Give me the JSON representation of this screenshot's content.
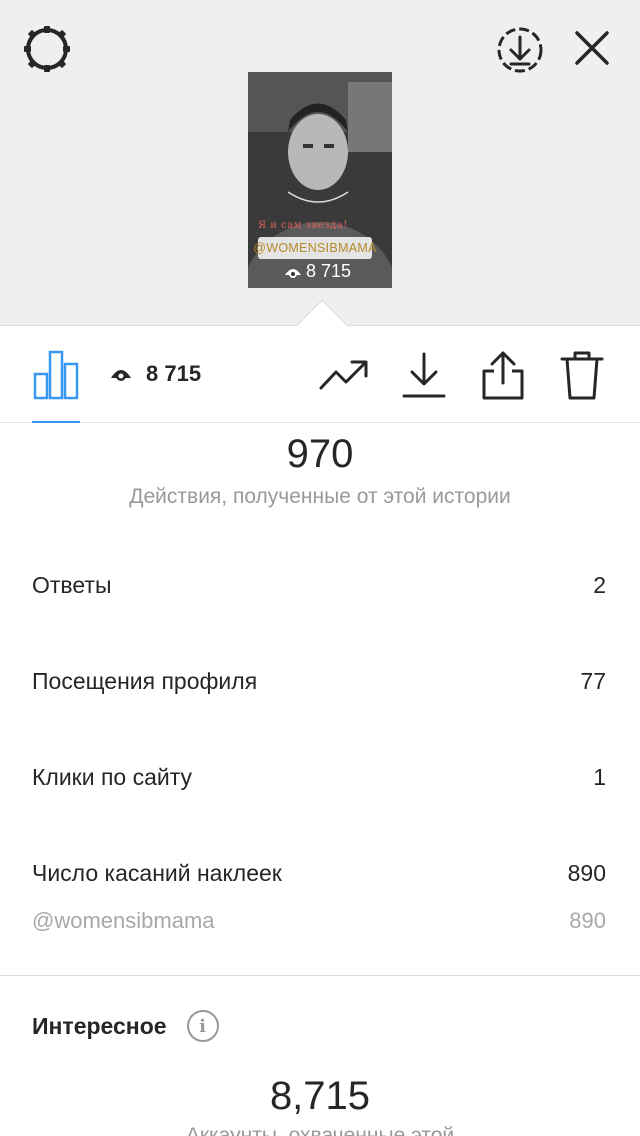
{
  "story": {
    "caption": "Я и сам звезда!",
    "mention_sticker": "@WOMENSIBMAMA",
    "views": "8 715"
  },
  "toolbar": {
    "views": "8 715"
  },
  "summary": {
    "value": "970",
    "description": "Действия, полученные от этой истории"
  },
  "rows": [
    {
      "label": "Ответы",
      "value": "2"
    },
    {
      "label": "Посещения профиля",
      "value": "77"
    },
    {
      "label": "Клики по сайту",
      "value": "1"
    },
    {
      "label": "Число касаний наклеек",
      "value": "890"
    }
  ],
  "sticker_row": {
    "label": "@womensibmama",
    "value": "890"
  },
  "discovery": {
    "title": "Интересное",
    "value": "8,715",
    "description": "Аккаунты, охваченные этой"
  },
  "colors": {
    "accent": "#3897f0",
    "muted": "#999999",
    "background_top": "#efefef"
  },
  "icons": [
    "settings-icon",
    "download-circle-icon",
    "close-icon",
    "bar-chart-icon",
    "eye-icon",
    "trend-icon",
    "download-icon",
    "share-icon",
    "trash-icon",
    "info-icon"
  ]
}
